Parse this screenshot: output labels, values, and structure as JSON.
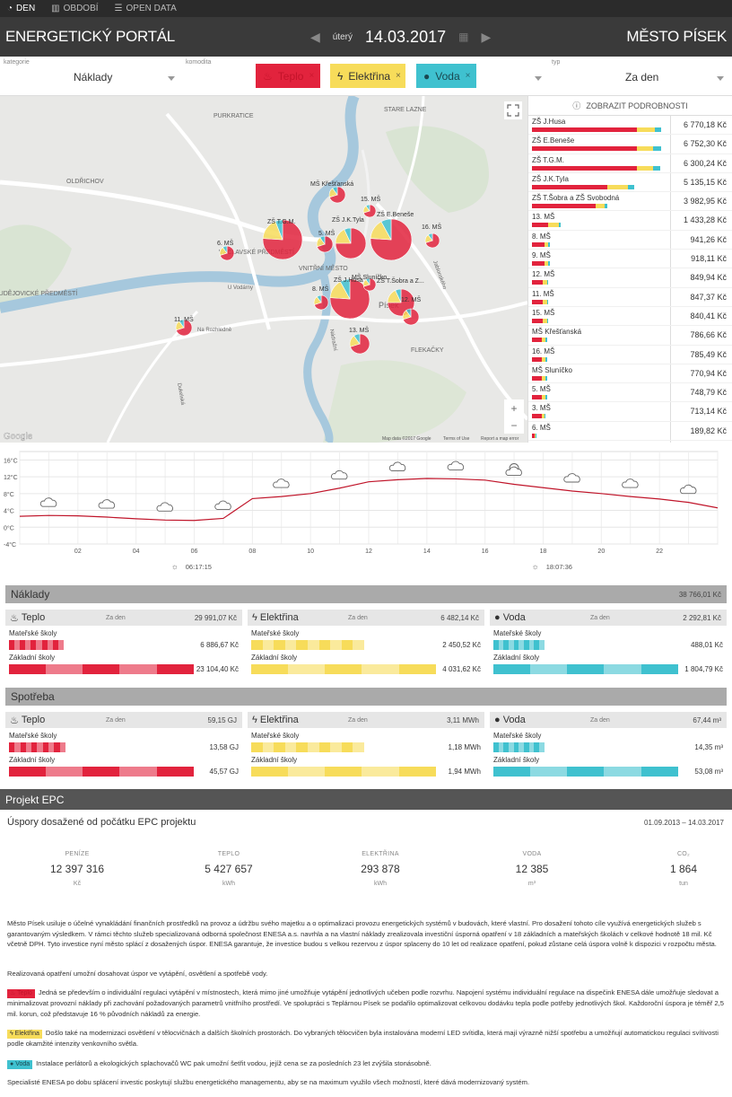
{
  "topnav": [
    {
      "label": "DEN",
      "icon": "pie-icon",
      "active": true
    },
    {
      "label": "OBDOBÍ",
      "icon": "bar-chart-icon",
      "active": false
    },
    {
      "label": "OPEN DATA",
      "icon": "database-icon",
      "active": false
    }
  ],
  "header": {
    "title": "ENERGETICKÝ PORTÁL",
    "day": "úterý",
    "date": "14.03.2017",
    "city": "MĚSTO PÍSEK"
  },
  "filters": {
    "kategorie_label": "kategorie",
    "kategorie_value": "Náklady",
    "komodita_label": "komodita",
    "chips": [
      {
        "label": "Teplo",
        "color": "#e2233d",
        "text": "#ffffff"
      },
      {
        "label": "Elektřina",
        "color": "#f7dc5a",
        "text": "#333333"
      },
      {
        "label": "Voda",
        "color": "#3fc1cf",
        "text": "#1a4850"
      }
    ],
    "typ_label": "typ",
    "typ_value": "Za den"
  },
  "map": {
    "districts": [
      "PURKRATICE",
      "STARE LAZNE",
      "OLDŘICHOV",
      "VÁCLAVSKÉ PŘEDMĚSTÍ",
      "VNITŘNÍ MĚSTO",
      "BUDĚJOVICKÉ PŘEDMĚSTÍ",
      "FLEKAČKY",
      "Písek"
    ],
    "streets": [
      "Na Rozhledně",
      "U Vodárny",
      "Jablonského",
      "Nádražní",
      "Dukelská"
    ],
    "labels": [
      "ZŠ T.G.M.",
      "MŠ Křešťanská",
      "15. MŠ",
      "ZŠ J.K.Tyla",
      "ZŠ E.Beneše",
      "5. MŠ",
      "6. MŠ",
      "16. MŠ",
      "ZŠ J.Husa",
      "MŠ Sluníčko",
      "ZŠ T.Šobra a Z...",
      "8. MŠ",
      "12. MŠ",
      "11. MŠ",
      "13. MŠ"
    ],
    "footer": [
      "Map data ©2017 Google",
      "Terms of Use",
      "Report a map error"
    ],
    "logo": "Google"
  },
  "details": {
    "label": "ZOBRAZIT PODROBNOSTI",
    "rows": [
      {
        "name": "ZŠ J.Husa",
        "value": "6 770,18 Kč",
        "parts": [
          0.78,
          0.13,
          0.05
        ]
      },
      {
        "name": "ZŠ E.Beneše",
        "value": "6 752,30 Kč",
        "parts": [
          0.78,
          0.12,
          0.06
        ]
      },
      {
        "name": "ZŠ T.G.M.",
        "value": "6 300,24 Kč",
        "parts": [
          0.78,
          0.12,
          0.05
        ]
      },
      {
        "name": "ZŠ J.K.Tyla",
        "value": "5 135,15 Kč",
        "parts": [
          0.56,
          0.15,
          0.05
        ]
      },
      {
        "name": "ZŠ T.Šobra a ZŠ Svobodná",
        "value": "3 982,95 Kč",
        "parts": [
          0.47,
          0.07,
          0.02
        ]
      },
      {
        "name": "13. MŠ",
        "value": "1 433,28 Kč",
        "parts": [
          0.12,
          0.08,
          0.01
        ]
      },
      {
        "name": "8. MŠ",
        "value": "941,26 Kč",
        "parts": [
          0.09,
          0.03,
          0.01
        ]
      },
      {
        "name": "9. MŠ",
        "value": "918,11 Kč",
        "parts": [
          0.09,
          0.03,
          0.01
        ]
      },
      {
        "name": "12. MŠ",
        "value": "849,94 Kč",
        "parts": [
          0.08,
          0.03,
          0.01
        ]
      },
      {
        "name": "11. MŠ",
        "value": "847,37 Kč",
        "parts": [
          0.08,
          0.03,
          0.01
        ]
      },
      {
        "name": "15. MŠ",
        "value": "840,41 Kč",
        "parts": [
          0.08,
          0.03,
          0.01
        ]
      },
      {
        "name": "MŠ Křešťanská",
        "value": "786,66 Kč",
        "parts": [
          0.07,
          0.03,
          0.01
        ]
      },
      {
        "name": "16. MŠ",
        "value": "785,49 Kč",
        "parts": [
          0.07,
          0.03,
          0.01
        ]
      },
      {
        "name": "MŠ Sluníčko",
        "value": "770,94 Kč",
        "parts": [
          0.07,
          0.03,
          0.01
        ]
      },
      {
        "name": "5. MŠ",
        "value": "748,79 Kč",
        "parts": [
          0.07,
          0.03,
          0.01
        ]
      },
      {
        "name": "3. MŠ",
        "value": "713,14 Kč",
        "parts": [
          0.07,
          0.02,
          0.01
        ]
      },
      {
        "name": "6. MŠ",
        "value": "189,82 Kč",
        "parts": [
          0.02,
          0.005,
          0.005
        ]
      }
    ]
  },
  "chart_data": {
    "type": "line",
    "title": "",
    "ylabel": "",
    "xlabel": "",
    "yticks": [
      "16°C",
      "12°C",
      "8°C",
      "4°C",
      "0°C",
      "-4°C"
    ],
    "ylim": [
      -4,
      18
    ],
    "xlim": [
      0,
      24
    ],
    "xticks": [
      "02",
      "04",
      "06",
      "08",
      "10",
      "12",
      "14",
      "16",
      "18",
      "20",
      "22"
    ],
    "series": [
      {
        "values": [
          [
            0,
            2.6
          ],
          [
            1,
            2.8
          ],
          [
            2,
            2.7
          ],
          [
            3,
            2.4
          ],
          [
            4,
            2.0
          ],
          [
            5,
            1.7
          ],
          [
            6,
            1.6
          ],
          [
            7,
            2.1
          ],
          [
            8,
            6.8
          ],
          [
            9,
            7.3
          ],
          [
            10,
            8.0
          ],
          [
            11,
            9.3
          ],
          [
            12,
            10.8
          ],
          [
            13,
            11.3
          ],
          [
            14,
            11.6
          ],
          [
            15,
            11.5
          ],
          [
            16,
            11.2
          ],
          [
            17,
            10.2
          ],
          [
            18,
            9.4
          ],
          [
            19,
            8.6
          ],
          [
            20,
            8.0
          ],
          [
            21,
            7.3
          ],
          [
            22,
            6.7
          ],
          [
            23,
            5.9
          ],
          [
            24,
            4.6
          ]
        ]
      }
    ],
    "sunrise": "06:17:15",
    "sunset": "18:07:36",
    "weather": [
      {
        "h": 1,
        "icon": "cloud-icon"
      },
      {
        "h": 3,
        "icon": "night-cloud-icon"
      },
      {
        "h": 5,
        "icon": "night-cloud-icon"
      },
      {
        "h": 7,
        "icon": "cloud-icon"
      },
      {
        "h": 9,
        "icon": "cloud-icon"
      },
      {
        "h": 11,
        "icon": "cloud-icon"
      },
      {
        "h": 13,
        "icon": "cloud-icon"
      },
      {
        "h": 15,
        "icon": "cloud-icon"
      },
      {
        "h": 17,
        "icon": "sun-cloud-icon"
      },
      {
        "h": 19,
        "icon": "cloud-icon"
      },
      {
        "h": 21,
        "icon": "cloud-icon"
      },
      {
        "h": 23,
        "icon": "night-cloud-icon"
      }
    ]
  },
  "naklady": {
    "title": "Náklady",
    "total": "38 766,01 Kč",
    "cards": [
      {
        "name": "Teplo",
        "period": "Za den",
        "sum": "29 991,07 Kč",
        "ms": "6 886,67 Kč",
        "zs": "23 104,40 Kč",
        "color": "#e2233d",
        "ms_w": 0.29,
        "zs_w": 0.98
      },
      {
        "name": "Elektřina",
        "period": "Za den",
        "sum": "6 482,14 Kč",
        "ms": "2 450,52 Kč",
        "zs": "4 031,62 Kč",
        "color": "#f7dc5a",
        "ms_w": 0.6,
        "zs_w": 0.98
      },
      {
        "name": "Voda",
        "period": "Za den",
        "sum": "2 292,81 Kč",
        "ms": "488,01 Kč",
        "zs": "1 804,79 Kč",
        "color": "#3fc1cf",
        "ms_w": 0.27,
        "zs_w": 0.98
      }
    ]
  },
  "spotreba": {
    "title": "Spotřeba",
    "cards": [
      {
        "name": "Teplo",
        "period": "Za den",
        "sum": "59,15 GJ",
        "ms": "13,58 GJ",
        "zs": "45,57 GJ",
        "color": "#e2233d",
        "ms_w": 0.3,
        "zs_w": 0.98
      },
      {
        "name": "Elektřina",
        "period": "Za den",
        "sum": "3,11 MWh",
        "ms": "1,18 MWh",
        "zs": "1,94 MWh",
        "color": "#f7dc5a",
        "ms_w": 0.6,
        "zs_w": 0.98
      },
      {
        "name": "Voda",
        "period": "Za den",
        "sum": "67,44 m³",
        "ms": "14,35 m³",
        "zs": "53,08 m³",
        "color": "#3fc1cf",
        "ms_w": 0.27,
        "zs_w": 0.98
      }
    ]
  },
  "card_labels": {
    "ms": "Mateřské školy",
    "zs": "Základní školy"
  },
  "epc": {
    "title": "Projekt EPC",
    "subtitle": "Úspory dosažené od počátku EPC projektu",
    "range": "01.09.2013 – 14.03.2017",
    "stats": [
      {
        "label": "PENÍZE",
        "value": "12 397 316",
        "unit": "Kč"
      },
      {
        "label": "TEPLO",
        "value": "5 427 657",
        "unit": "kWh"
      },
      {
        "label": "ELEKTŘINA",
        "value": "293 878",
        "unit": "kWh"
      },
      {
        "label": "VODA",
        "value": "12 385",
        "unit": "m³"
      },
      {
        "label": "CO₂",
        "value": "1 864",
        "unit": "tun"
      }
    ],
    "p1": "Město Písek usiluje o účelné vynakládání finančních prostředků na provoz a údržbu svého majetku a o optimalizaci provozu energetických systémů v budovách, které vlastní. Pro dosažení tohoto cíle využívá energetických služeb s garantovaným výsledkem. V rámci těchto služeb specializovaná odborná společnost ENESA a.s. navrhla a na vlastní náklady zrealizovala investiční úsporná opatření v 18 základních a mateřských školách v celkové hodnotě 18 mil. Kč včetně DPH. Tyto investice nyní město splácí z dosažených úspor. ENESA garantuje, že investice budou s velkou rezervou z úspor splaceny do 10 let od realizace opatření, pokud zůstane celá úspora volně k dispozici v rozpočtu města.",
    "p2": "Realizovaná opatření umožní dosahovat úspor ve vytápění, osvětlení a spotřebě vody.",
    "t1": "Teplo",
    "p3": "Jedná se především o individuální regulaci vytápění v místnostech, která mimo jiné umožňuje vytápění jednotlivých učeben podle rozvrhu. Napojení systému individuální regulace na dispečink ENESA dále umožňuje sledovat a minimalizovat provozní náklady při zachování požadovaných parametrů vnitřního prostředí. Ve spolupráci s Teplárnou Písek se podařilo optimalizovat celkovou dodávku tepla podle potřeby jednotlivých škol. Každoroční úspora je téměř 2,5 mil. korun, což představuje 16 % původních nákladů za energie.",
    "t2": "Elektřina",
    "p4": "Došlo také na modernizaci osvětlení v tělocvičnách a dalších školních prostorách. Do vybraných tělocvičen byla instalována moderní LED svítidla, která mají výrazně nižší spotřebu a umožňují automatickou regulaci svítivosti podle okamžité intenzity venkovního světla.",
    "t3": "Voda",
    "p5": "Instalace perlátorů a ekologických splachovačů WC pak umožní šetřit vodou, jejíž cena se za posledních 23 let zvýšila stonásobně.",
    "p6": "Specialisté ENESA po dobu splácení investic poskytují službu energetického managementu, aby se na maximum využilo všech možností, které dává modernizovaný systém."
  }
}
